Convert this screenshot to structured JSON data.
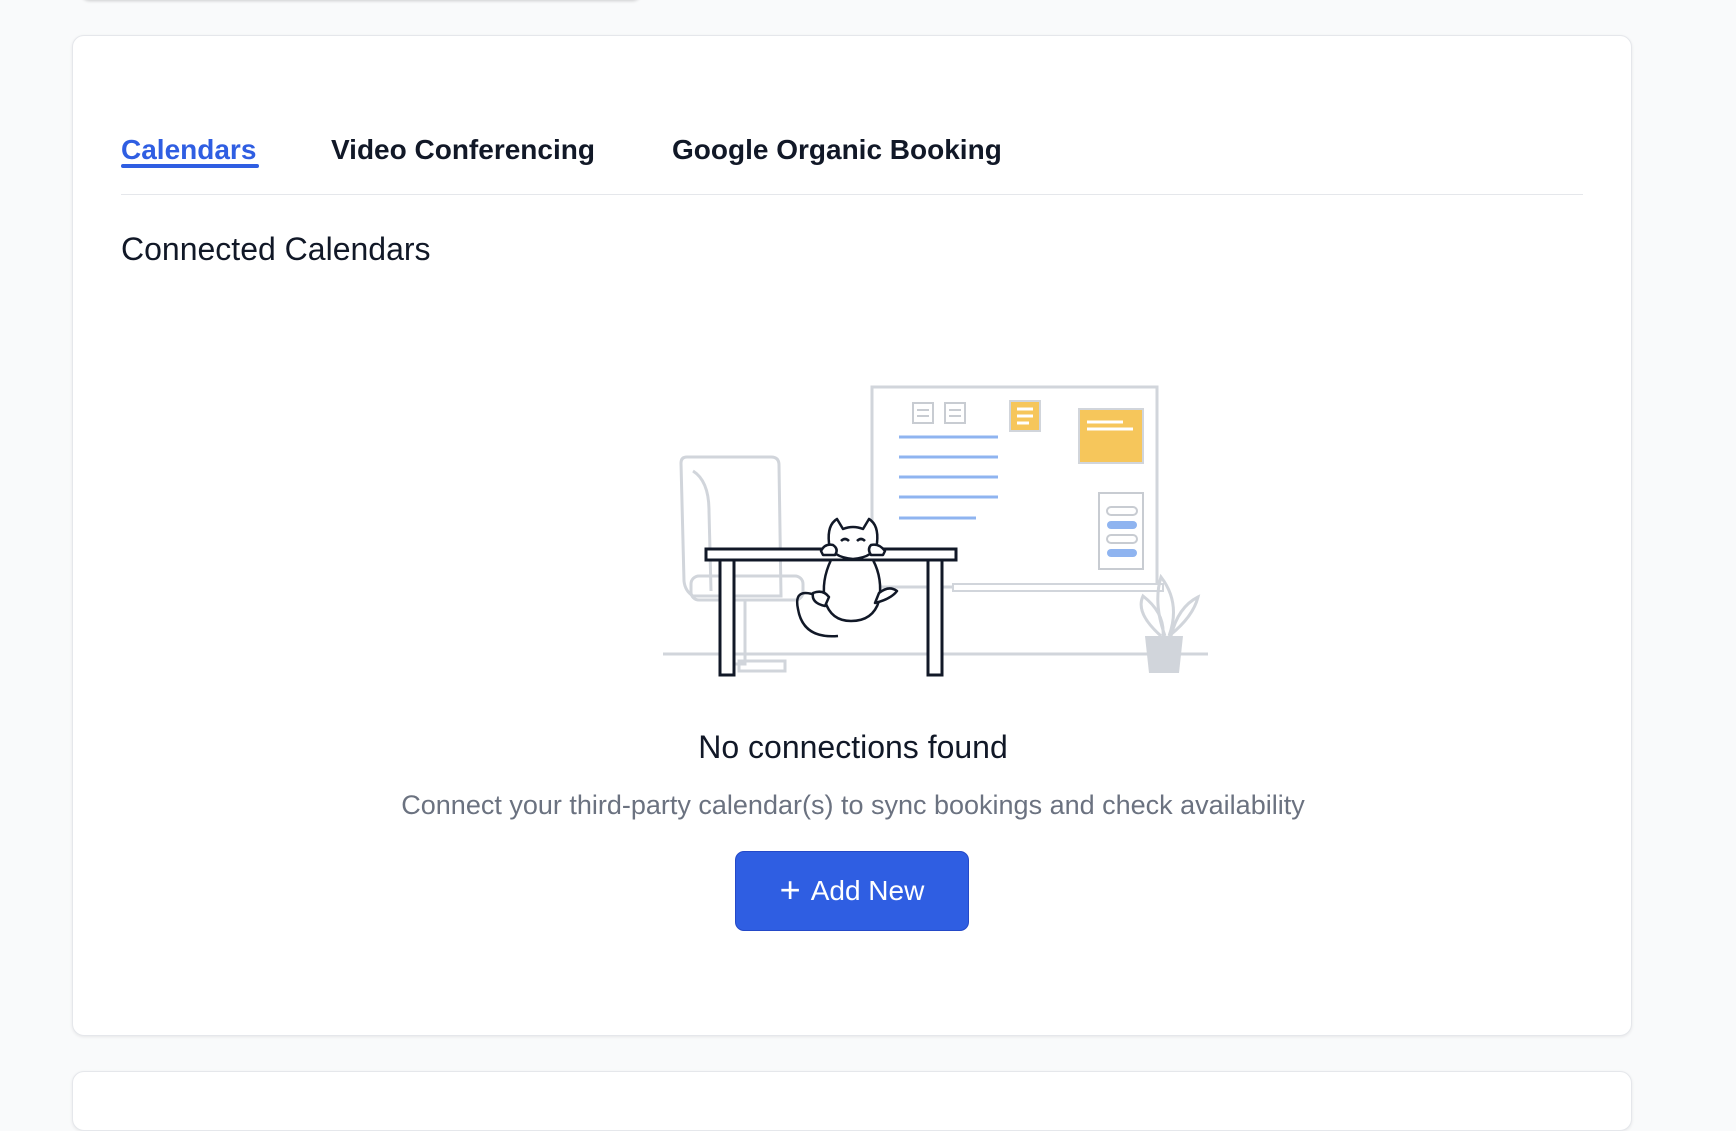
{
  "tabs": [
    {
      "label": "Calendars",
      "active": true
    },
    {
      "label": "Video Conferencing",
      "active": false
    },
    {
      "label": "Google Organic Booking",
      "active": false
    }
  ],
  "section": {
    "title": "Connected Calendars"
  },
  "empty_state": {
    "illustration": "cat-at-desk-illustration",
    "title": "No connections found",
    "description": "Connect your third-party calendar(s) to sync bookings and check availability"
  },
  "add_button": {
    "icon": "plus-icon",
    "label": "Add New"
  },
  "colors": {
    "accent": "#2f5ee2",
    "text_primary": "#111827",
    "text_secondary": "#6b7280",
    "border": "#e5e7eb",
    "sticky_note": "#f6c65b",
    "illustration_line": "#8fb4f0"
  }
}
